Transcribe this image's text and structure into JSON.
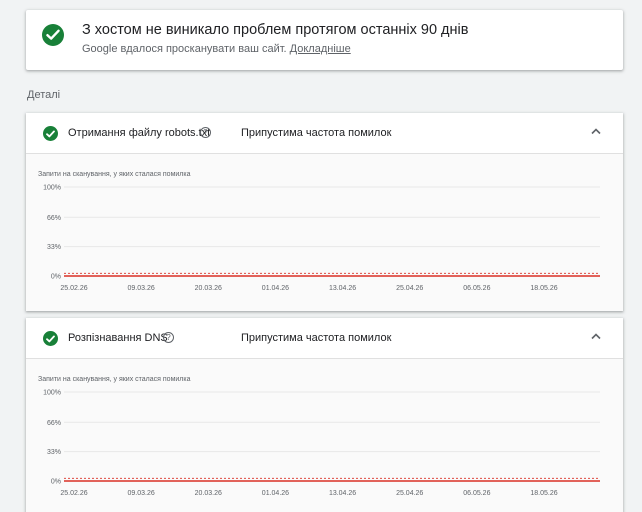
{
  "summary": {
    "title": "З хостом не виникало проблем протягом останніх 90 днів",
    "subtitle": "Google вдалося просканувати ваш сайт.",
    "link": "Докладніше",
    "status_color": "#188038"
  },
  "details_label": "Деталі",
  "panels": [
    {
      "title": "Отримання файлу robots.txt",
      "status": "Припустима частота помилок",
      "help_icon": "help-circle-icon",
      "toggle_icon": "chevron-up-icon"
    },
    {
      "title": "Розпізнавання DNS",
      "status": "Припустима частота помилок",
      "help_icon": "help-circle-icon",
      "toggle_icon": "chevron-up-icon"
    }
  ],
  "chart_data": [
    {
      "type": "line",
      "title": "",
      "ylabel": "Запити на сканування, у яких сталася помилка",
      "xlabel": "",
      "y_ticks": [
        "100%",
        "66%",
        "33%",
        "0%"
      ],
      "y_tick_values": [
        100,
        66,
        33,
        0
      ],
      "ylim": [
        0,
        100
      ],
      "x_ticks": [
        "25.02.26",
        "09.03.26",
        "20.03.26",
        "01.04.26",
        "13.04.26",
        "25.04.26",
        "06.05.26",
        "18.05.26"
      ],
      "series": [
        {
          "values": [
            0,
            0,
            0,
            0,
            0,
            0,
            0,
            0
          ],
          "color": "#d93025"
        }
      ],
      "threshold": {
        "value": 3,
        "style": "dashed",
        "color": "#d93025"
      },
      "grid": true
    },
    {
      "type": "line",
      "title": "",
      "ylabel": "Запити на сканування, у яких сталася помилка",
      "xlabel": "",
      "y_ticks": [
        "100%",
        "66%",
        "33%",
        "0%"
      ],
      "y_tick_values": [
        100,
        66,
        33,
        0
      ],
      "ylim": [
        0,
        100
      ],
      "x_ticks": [
        "25.02.26",
        "09.03.26",
        "20.03.26",
        "01.04.26",
        "13.04.26",
        "25.04.26",
        "06.05.26",
        "18.05.26"
      ],
      "series": [
        {
          "values": [
            0,
            0,
            0,
            0,
            0,
            0,
            0,
            0
          ],
          "color": "#d93025"
        }
      ],
      "threshold": {
        "value": 3,
        "style": "dashed",
        "color": "#d93025"
      },
      "grid": true
    }
  ]
}
